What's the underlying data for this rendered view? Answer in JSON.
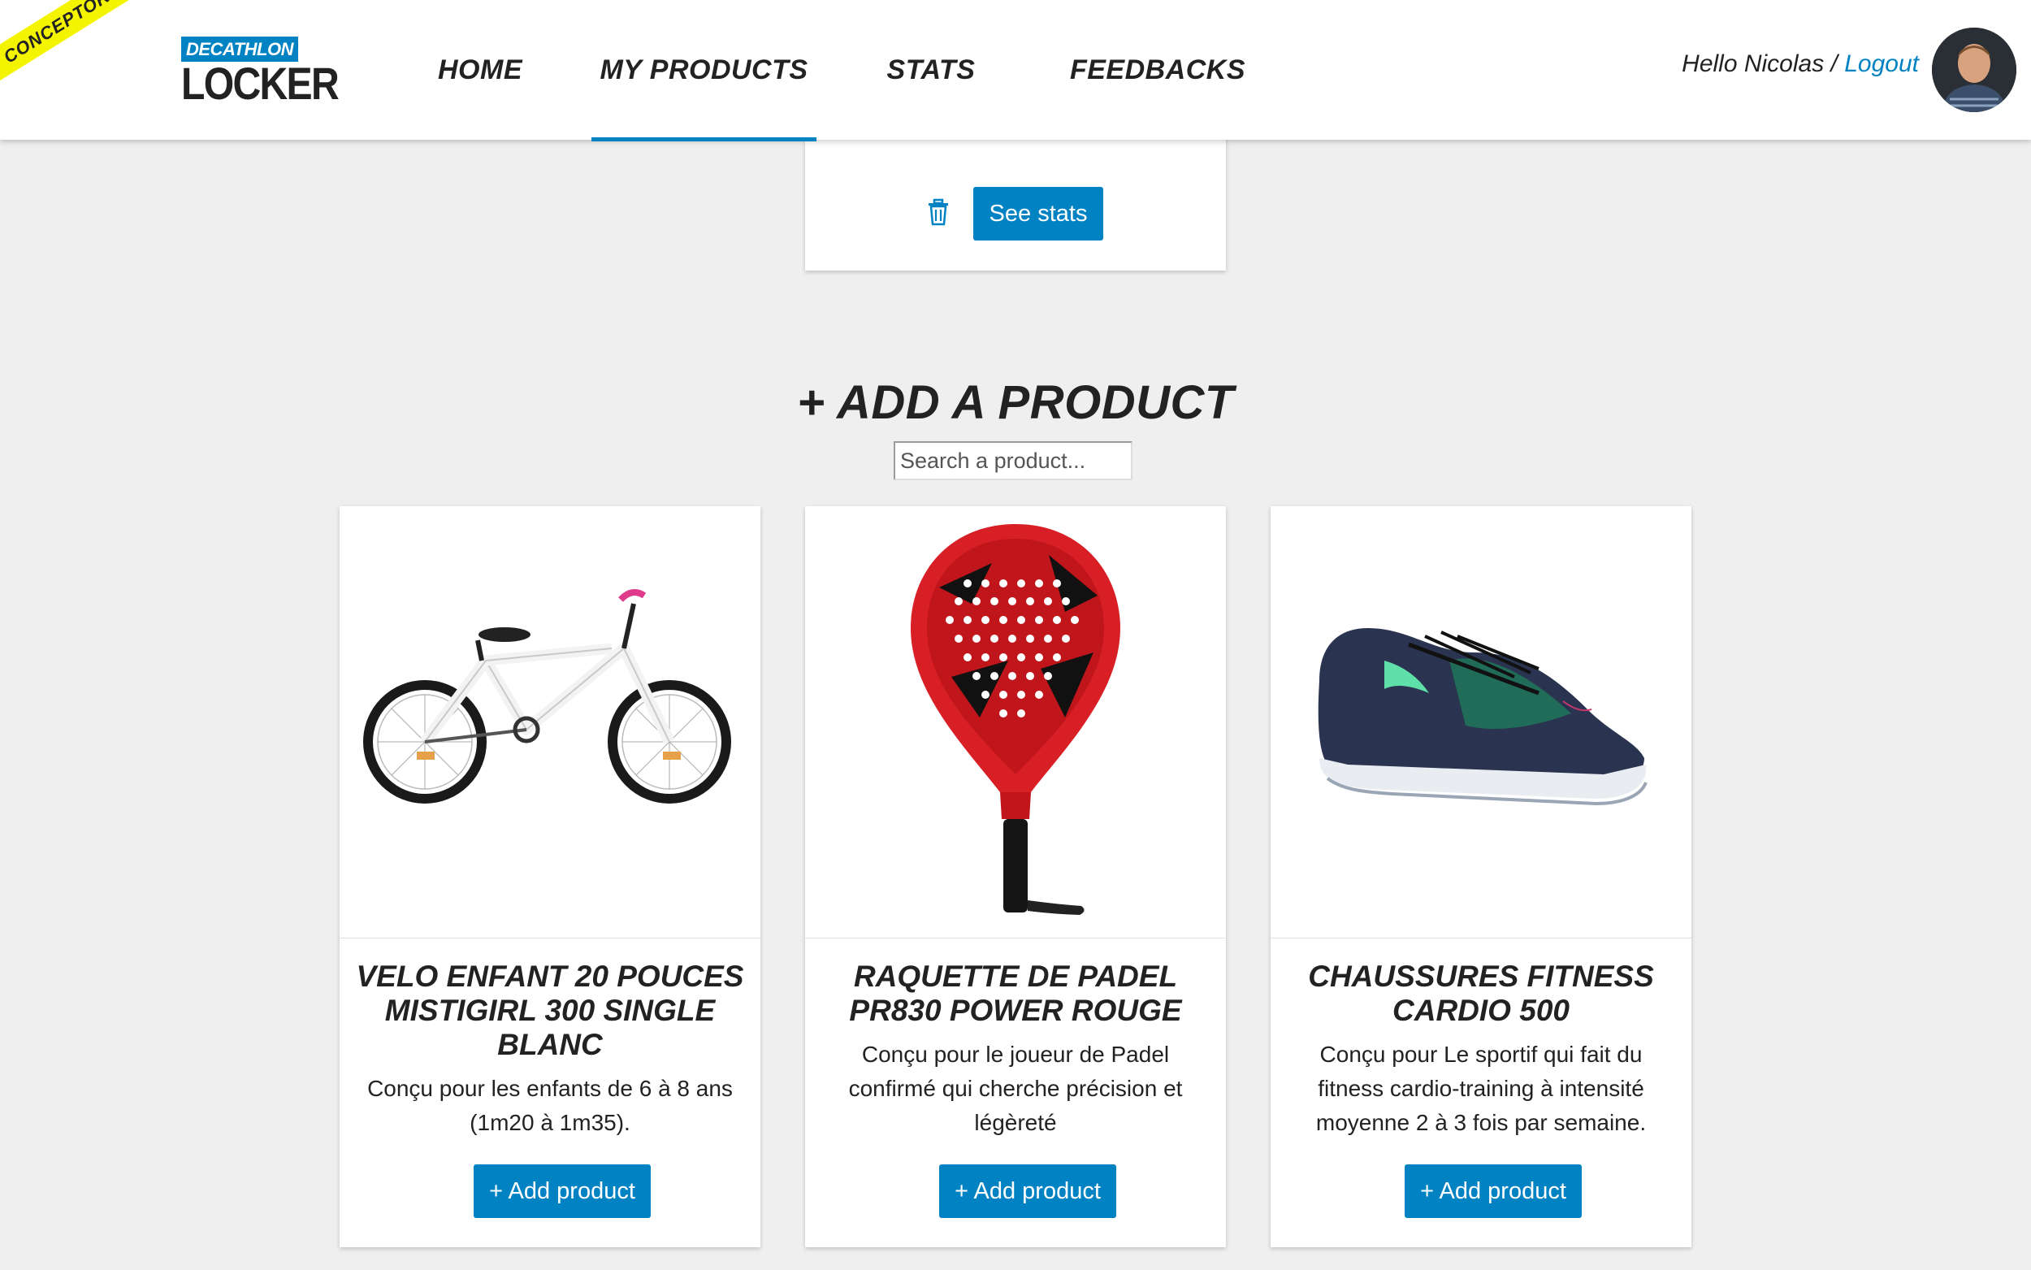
{
  "ribbon": {
    "label": "CONCEPTOR"
  },
  "logo": {
    "brand": "DECATHLON",
    "name": "LOCKER"
  },
  "nav": {
    "items": [
      "HOME",
      "MY PRODUCTS",
      "STATS",
      "FEEDBACKS"
    ],
    "active": "MY PRODUCTS"
  },
  "user": {
    "greeting": "Hello Nicolas /",
    "logout": "Logout"
  },
  "top_card": {
    "button": "See stats"
  },
  "add_section": {
    "title": "+ ADD A PRODUCT",
    "search_placeholder": "Search a product..."
  },
  "products": [
    {
      "image": "kids-bike-icon",
      "title": "VELO ENFANT 20 POUCES MISTIGIRL 300 SINGLE BLANC",
      "description": "Conçu pour les enfants de 6 à 8 ans (1m20 à 1m35).",
      "button": "+ Add product"
    },
    {
      "image": "padel-racket-icon",
      "title": "RAQUETTE DE PADEL PR830 POWER ROUGE",
      "description": "Conçu pour le joueur de Padel confirmé qui cherche précision et légèreté",
      "button": "+ Add product"
    },
    {
      "image": "fitness-shoe-icon",
      "title": "CHAUSSURES FITNESS CARDIO 500",
      "description": "Conçu pour Le sportif qui fait du fitness cardio-training à intensité moyenne 2 à 3 fois par semaine.",
      "button": "+ Add product"
    }
  ],
  "colors": {
    "accent": "#0082c3",
    "background": "#efefef",
    "ribbon": "#f4f400"
  }
}
